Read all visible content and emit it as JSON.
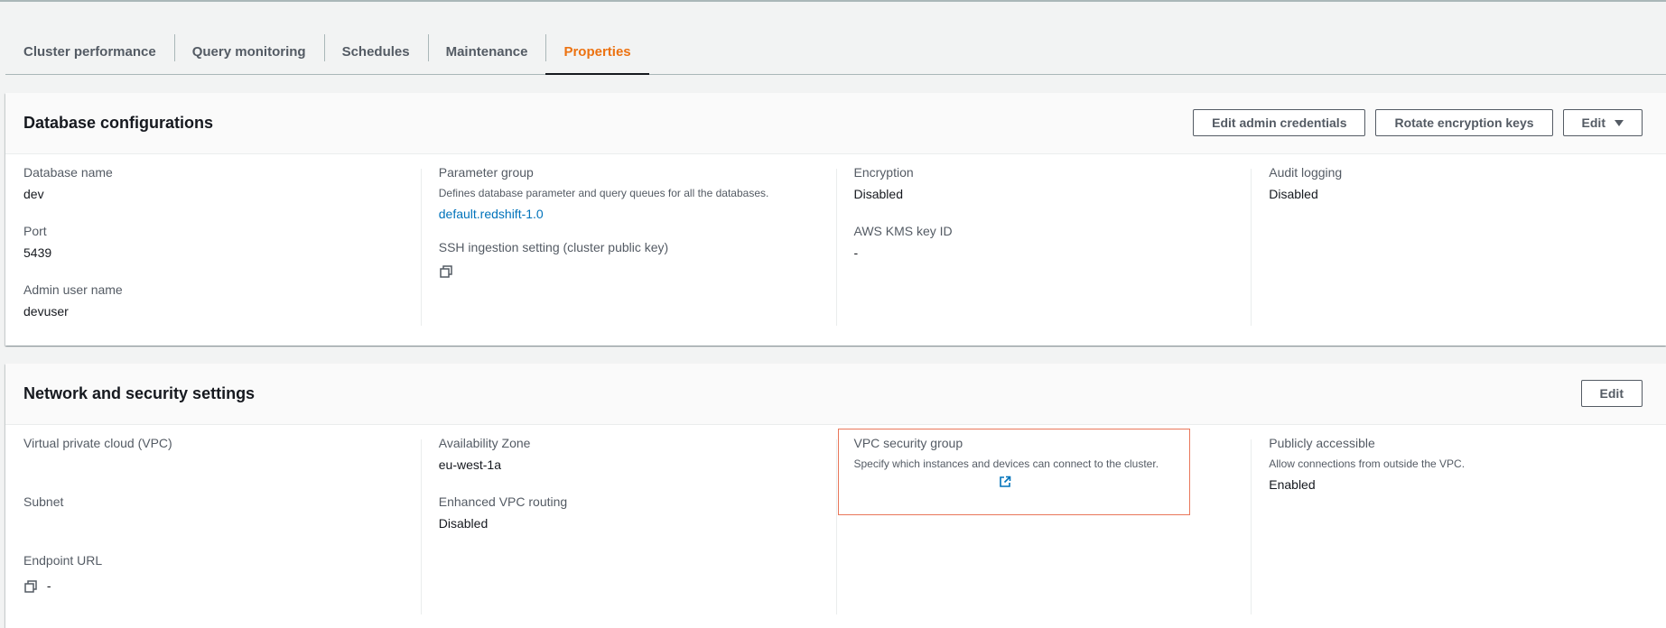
{
  "tabs": [
    {
      "label": "Cluster performance"
    },
    {
      "label": "Query monitoring"
    },
    {
      "label": "Schedules"
    },
    {
      "label": "Maintenance"
    },
    {
      "label": "Properties"
    }
  ],
  "db_config": {
    "title": "Database configurations",
    "actions": {
      "edit_admin_credentials": "Edit admin credentials",
      "rotate_encryption_keys": "Rotate encryption keys",
      "edit": "Edit"
    },
    "database_name": {
      "label": "Database name",
      "value": "dev"
    },
    "port": {
      "label": "Port",
      "value": "5439"
    },
    "admin_user": {
      "label": "Admin user name",
      "value": "devuser"
    },
    "parameter_group": {
      "label": "Parameter group",
      "description": "Defines database parameter and query queues for all the databases.",
      "value": "default.redshift-1.0"
    },
    "ssh_ingestion": {
      "label": "SSH ingestion setting (cluster public key)"
    },
    "encryption": {
      "label": "Encryption",
      "value": "Disabled"
    },
    "kms_key": {
      "label": "AWS KMS key ID",
      "value": "-"
    },
    "audit_logging": {
      "label": "Audit logging",
      "value": "Disabled"
    }
  },
  "network": {
    "title": "Network and security settings",
    "edit": "Edit",
    "vpc": {
      "label": "Virtual private cloud (VPC)"
    },
    "subnet": {
      "label": "Subnet"
    },
    "endpoint": {
      "label": "Endpoint URL",
      "value": "-"
    },
    "availability_zone": {
      "label": "Availability Zone",
      "value": "eu-west-1a"
    },
    "enhanced_vpc_routing": {
      "label": "Enhanced VPC routing",
      "value": "Disabled"
    },
    "vpc_security_group": {
      "label": "VPC security group",
      "description": "Specify which instances and devices can connect to the cluster."
    },
    "publicly_accessible": {
      "label": "Publicly accessible",
      "description": "Allow connections from outside the VPC.",
      "value": "Enabled"
    }
  },
  "icons": {
    "copy": "copy-icon",
    "external_link": "external-link-icon",
    "caret": "caret-down-icon"
  },
  "colors": {
    "accent": "#ec7211",
    "link": "#0073bb",
    "highlight": "#e9775a"
  }
}
